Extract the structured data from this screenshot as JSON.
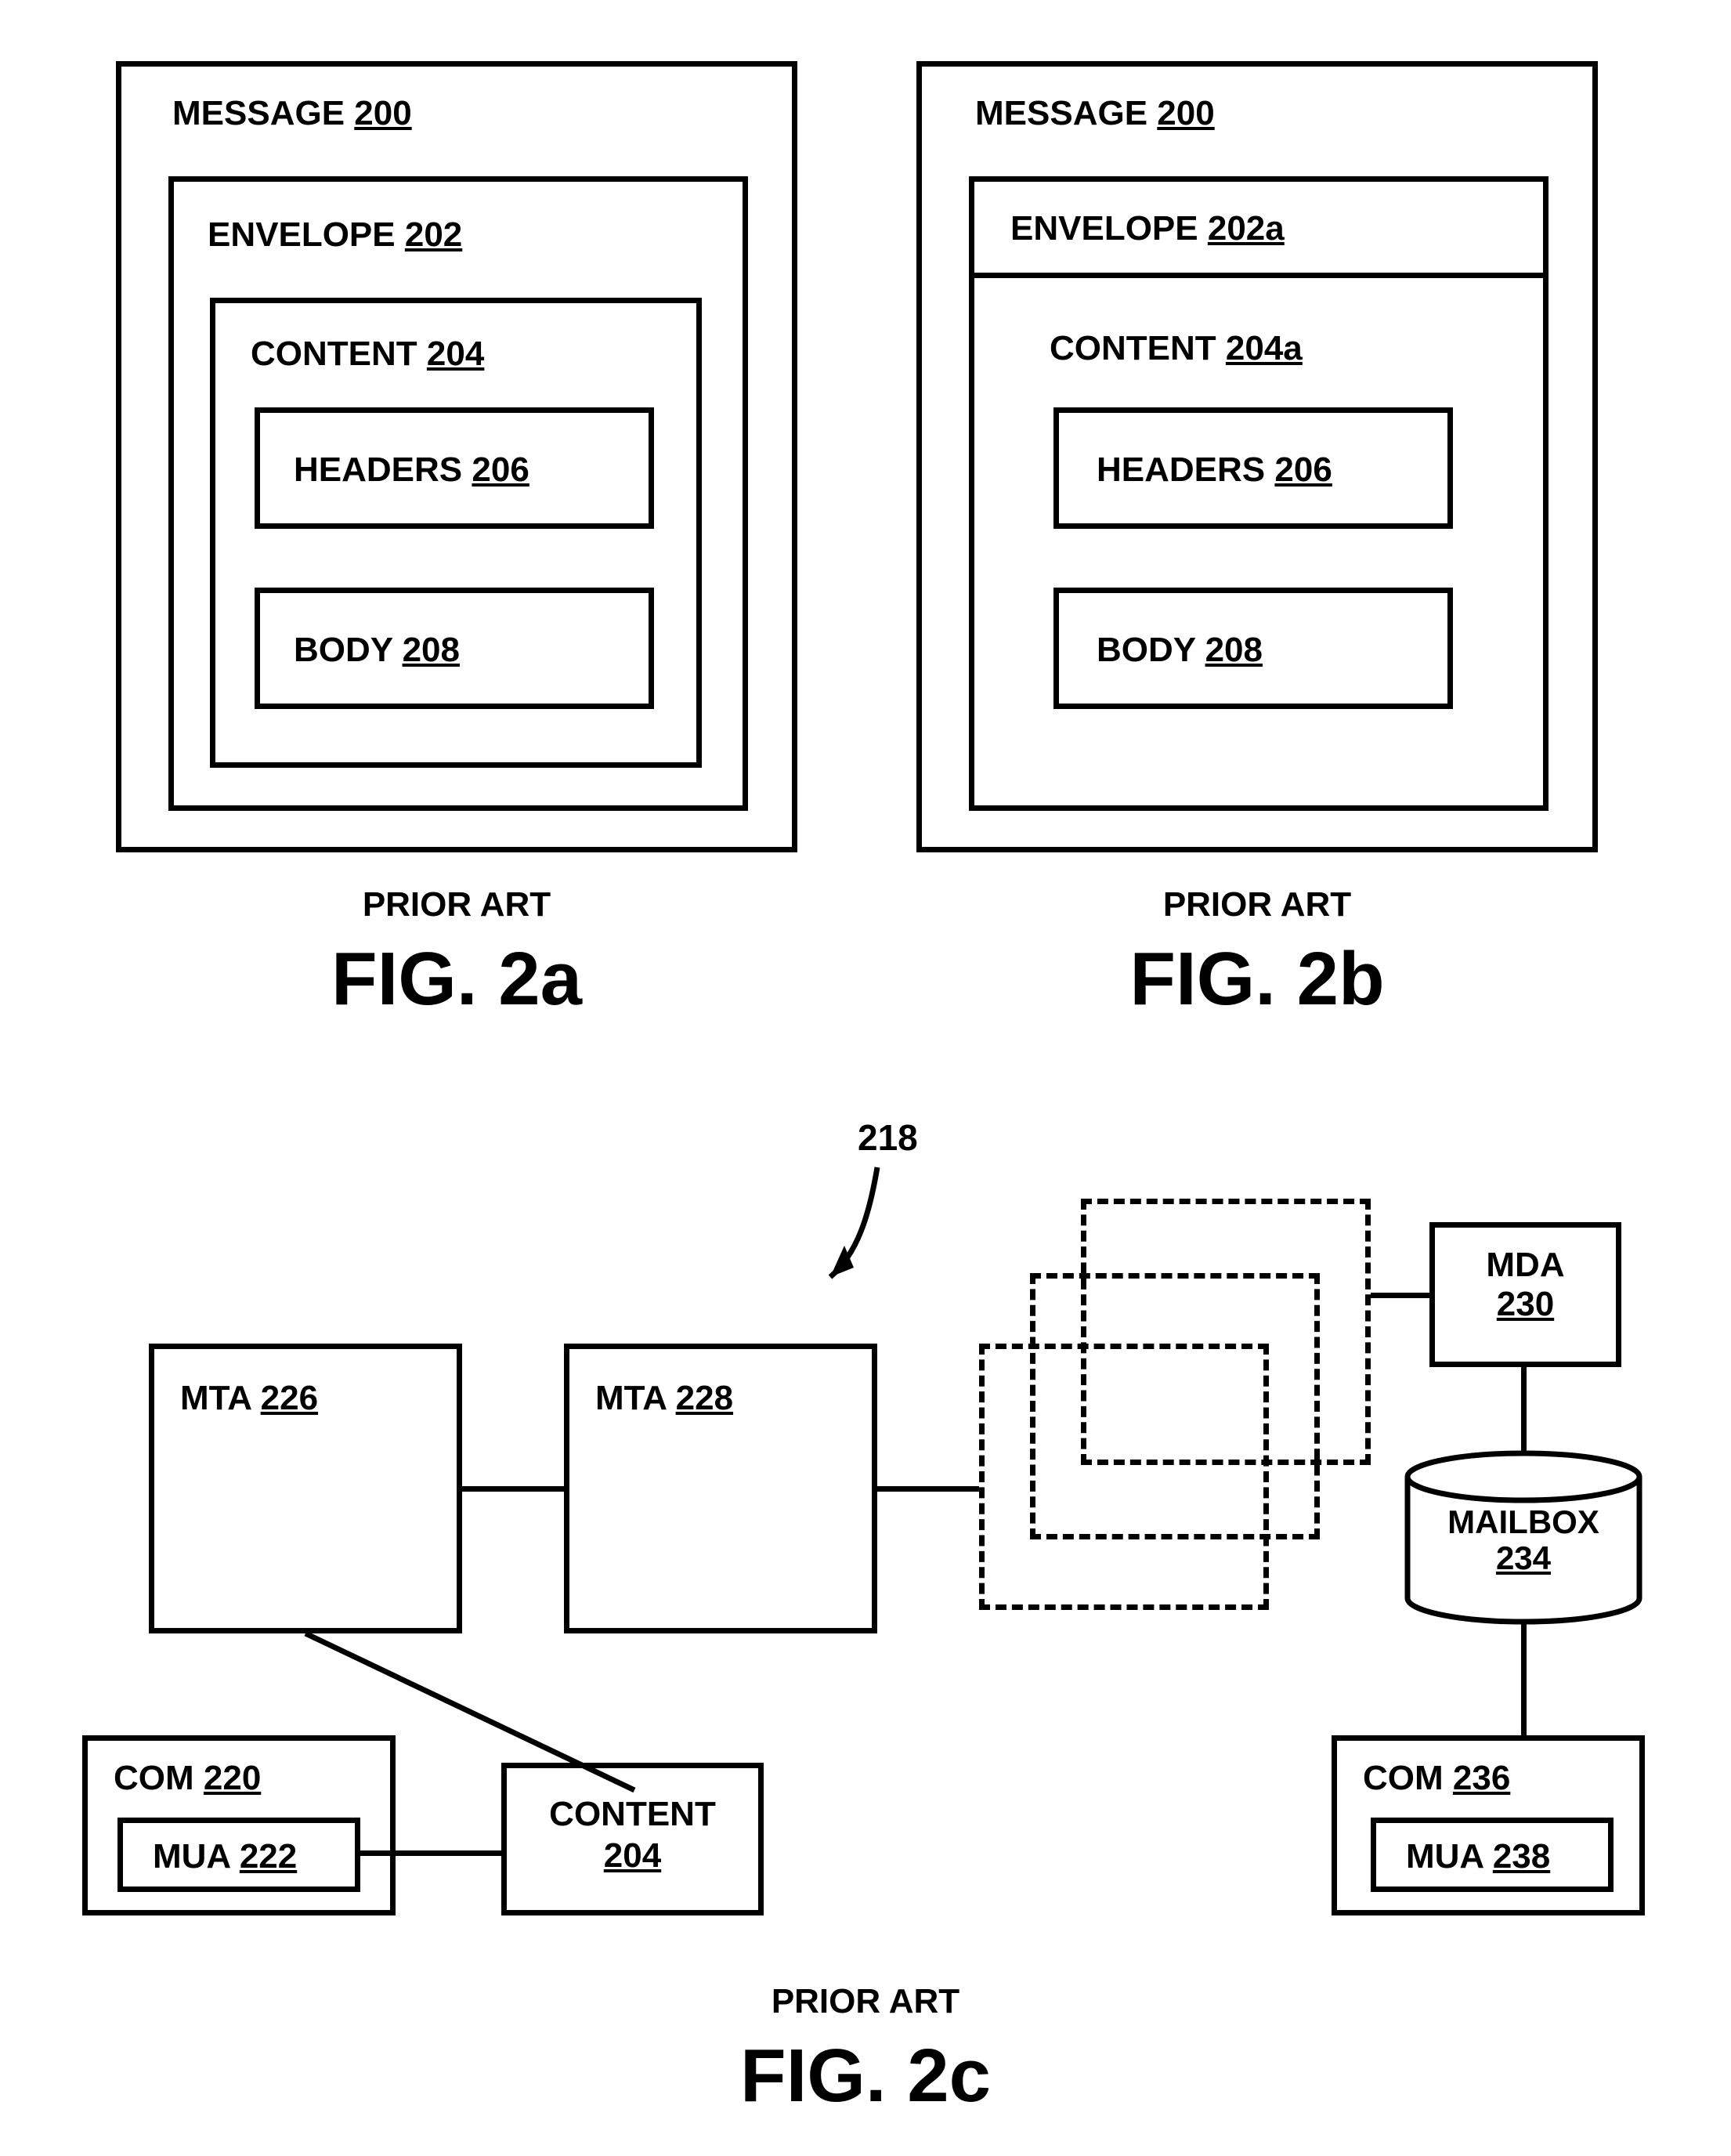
{
  "fig2a": {
    "message_label": "MESSAGE",
    "message_num": "200",
    "envelope_label": "ENVELOPE",
    "envelope_num": "202",
    "content_label": "CONTENT",
    "content_num": "204",
    "headers_label": "HEADERS",
    "headers_num": "206",
    "body_label": "BODY",
    "body_num": "208",
    "prior_art": "PRIOR ART",
    "title": "FIG. 2a"
  },
  "fig2b": {
    "message_label": "MESSAGE",
    "message_num": "200",
    "envelope_label": "ENVELOPE",
    "envelope_num": "202a",
    "content_label": "CONTENT",
    "content_num": "204a",
    "headers_label": "HEADERS",
    "headers_num": "206",
    "body_label": "BODY",
    "body_num": "208",
    "prior_art": "PRIOR ART",
    "title": "FIG. 2b"
  },
  "fig2c": {
    "ref_num": "218",
    "mta1_label": "MTA",
    "mta1_num": "226",
    "mta2_label": "MTA",
    "mta2_num": "228",
    "mda_label": "MDA",
    "mda_num": "230",
    "mailbox_label": "MAILBOX",
    "mailbox_num": "234",
    "com1_label": "COM",
    "com1_num": "220",
    "mua1_label": "MUA",
    "mua1_num": "222",
    "content_label": "CONTENT",
    "content_num": "204",
    "com2_label": "COM",
    "com2_num": "236",
    "mua2_label": "MUA",
    "mua2_num": "238",
    "prior_art": "PRIOR ART",
    "title": "FIG. 2c"
  }
}
